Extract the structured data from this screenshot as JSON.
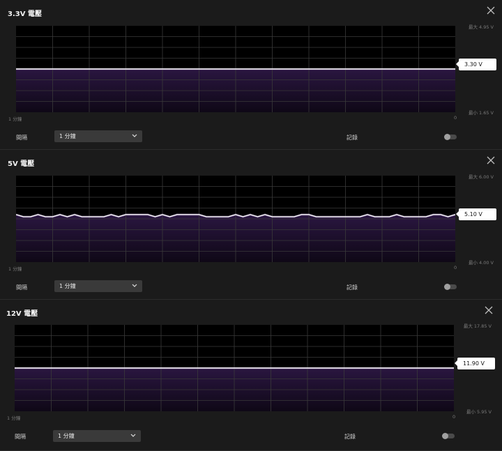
{
  "colors": {
    "line": "#ffffff",
    "fill": "#2a1640",
    "grid": "#3a3a3a",
    "chart_bg": "#000000",
    "panel_bg": "#1b1b1b",
    "accent_glow": "#b79ad6"
  },
  "panels": [
    {
      "title": "3.3V 電壓",
      "max_label": "最大 4.95 V",
      "min_label": "最小 1.65 V",
      "value_label": "3.30 V",
      "x_left_label": "1 分鐘",
      "x_right_label": "0",
      "interval_label": "間隔",
      "interval_value": "1 分鐘",
      "record_label": "記錄",
      "record_enabled": false
    },
    {
      "title": "5V 電壓",
      "max_label": "最大 6.00 V",
      "min_label": "最小 4.00 V",
      "value_label": "5.10 V",
      "x_left_label": "1 分鐘",
      "x_right_label": "0",
      "interval_label": "間隔",
      "interval_value": "1 分鐘",
      "record_label": "記錄",
      "record_enabled": false
    },
    {
      "title": "12V 電壓",
      "max_label": "最大 17.85 V",
      "min_label": "最小 5.95 V",
      "value_label": "11.90 V",
      "x_left_label": "1 分鐘",
      "x_right_label": "0",
      "interval_label": "間隔",
      "interval_value": "1 分鐘",
      "record_label": "記錄",
      "record_enabled": false
    }
  ],
  "chart_data": [
    {
      "type": "area",
      "title": "3.3V 電壓",
      "ylim": [
        1.65,
        4.95
      ],
      "x_range_label": [
        "1 分鐘",
        "0"
      ],
      "values": [
        3.3,
        3.3,
        3.3,
        3.3,
        3.3,
        3.3,
        3.3,
        3.3,
        3.3,
        3.3,
        3.3,
        3.3,
        3.3,
        3.3,
        3.3,
        3.3,
        3.3,
        3.3,
        3.3,
        3.3,
        3.3,
        3.3,
        3.3,
        3.3,
        3.3,
        3.3,
        3.3,
        3.3,
        3.3,
        3.3,
        3.3,
        3.3,
        3.3,
        3.3,
        3.3,
        3.3,
        3.3,
        3.3,
        3.3,
        3.3,
        3.3,
        3.3,
        3.3,
        3.3,
        3.3,
        3.3,
        3.3,
        3.3,
        3.3,
        3.3,
        3.3,
        3.3,
        3.3,
        3.3,
        3.3,
        3.3,
        3.3,
        3.3,
        3.3,
        3.3,
        3.3
      ],
      "grid": true
    },
    {
      "type": "area",
      "title": "5V 電壓",
      "ylim": [
        4.0,
        6.0
      ],
      "x_range_label": [
        "1 分鐘",
        "0"
      ],
      "values": [
        5.1,
        5.05,
        5.05,
        5.1,
        5.05,
        5.05,
        5.1,
        5.05,
        5.1,
        5.05,
        5.05,
        5.05,
        5.05,
        5.1,
        5.05,
        5.1,
        5.1,
        5.1,
        5.1,
        5.05,
        5.1,
        5.05,
        5.1,
        5.1,
        5.1,
        5.1,
        5.05,
        5.05,
        5.05,
        5.05,
        5.1,
        5.05,
        5.1,
        5.05,
        5.1,
        5.05,
        5.05,
        5.05,
        5.05,
        5.1,
        5.1,
        5.05,
        5.05,
        5.05,
        5.05,
        5.05,
        5.05,
        5.05,
        5.1,
        5.05,
        5.05,
        5.05,
        5.1,
        5.05,
        5.05,
        5.05,
        5.05,
        5.1,
        5.1,
        5.05,
        5.1
      ],
      "grid": true
    },
    {
      "type": "area",
      "title": "12V 電壓",
      "ylim": [
        5.95,
        17.85
      ],
      "x_range_label": [
        "1 分鐘",
        "0"
      ],
      "values": [
        11.9,
        11.9,
        11.9,
        11.9,
        11.9,
        11.9,
        11.9,
        11.9,
        11.9,
        11.9,
        11.9,
        11.9,
        11.9,
        11.9,
        11.9,
        11.9,
        11.9,
        11.9,
        11.9,
        11.9,
        11.9,
        11.9,
        11.9,
        11.9,
        11.9,
        11.9,
        11.9,
        11.9,
        11.9,
        11.9,
        11.9,
        11.9,
        11.9,
        11.9,
        11.9,
        11.9,
        11.9,
        11.9,
        11.9,
        11.9,
        11.9,
        11.9,
        11.9,
        11.9,
        11.9,
        11.9,
        11.9,
        11.9,
        11.9,
        11.9,
        11.9,
        11.9,
        11.9,
        11.9,
        11.9,
        11.9,
        11.9,
        11.9,
        11.9,
        11.9,
        11.9
      ],
      "grid": true
    }
  ]
}
